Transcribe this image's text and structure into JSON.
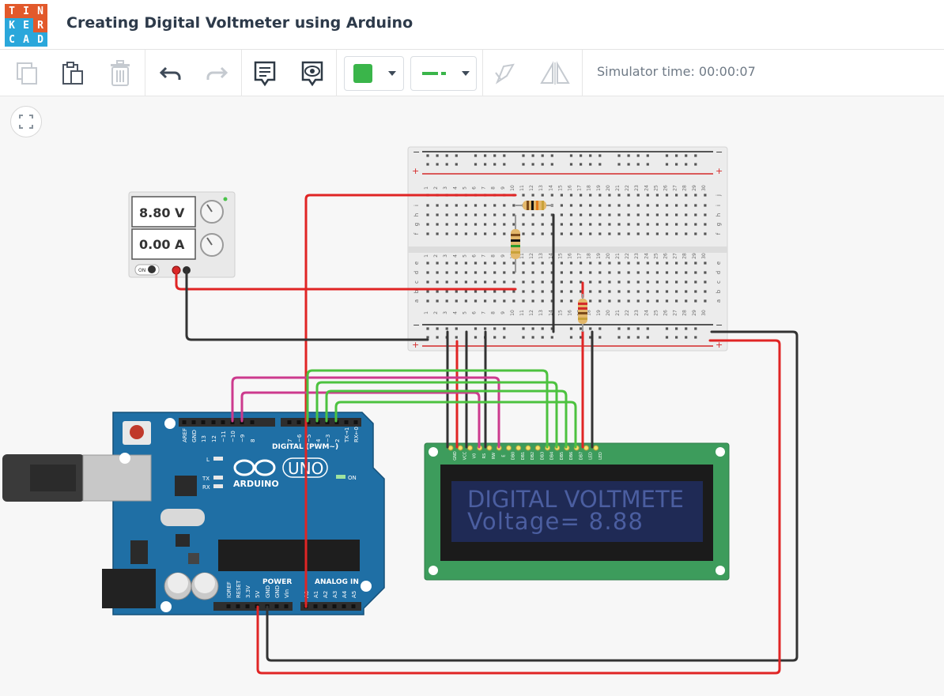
{
  "app": {
    "logo_letters": [
      "T",
      "I",
      "N",
      "K",
      "E",
      "R",
      "C",
      "A",
      "D"
    ],
    "logo_colors": [
      "#e2592b",
      "#e2592b",
      "#e2592b",
      "#2aa7db",
      "#2aa7db",
      "#e2592b",
      "#2aa7db",
      "#2aa7db",
      "#2aa7db"
    ],
    "title": "Creating Digital Voltmeter using Arduino"
  },
  "toolbar": {
    "copy_icon": "copy-icon",
    "paste_icon": "paste-icon",
    "delete_icon": "trash-icon",
    "undo_icon": "undo-icon",
    "redo_icon": "redo-icon",
    "notes_icon": "notes-icon",
    "view_icon": "eye-icon",
    "fill_color": "#3ab54a",
    "line_color": "#3ab54a",
    "rotate_icon": "rotate-icon",
    "mirror_icon": "mirror-icon",
    "simulator_time": "Simulator time: 00:00:07"
  },
  "power_supply": {
    "voltage": "8.80 V",
    "current": "0.00 A",
    "switch_label": "ON"
  },
  "breadboard": {
    "rail_minus": "−",
    "rail_plus": "+",
    "column_numbers": [
      "1",
      "2",
      "3",
      "4",
      "5",
      "6",
      "7",
      "8",
      "9",
      "10",
      "11",
      "12",
      "13",
      "14",
      "15",
      "16",
      "17",
      "18",
      "19",
      "20",
      "21",
      "22",
      "23",
      "24",
      "25",
      "26",
      "27",
      "28",
      "29",
      "30"
    ],
    "row_letters_top": [
      "j",
      "i",
      "h",
      "g",
      "f"
    ],
    "row_letters_bottom": [
      "e",
      "d",
      "c",
      "b",
      "a"
    ]
  },
  "arduino": {
    "logo_text": "ARDUINO",
    "model": "UNO",
    "digital_label": "DIGITAL (PWM~)",
    "power_label": "POWER",
    "analog_label": "ANALOG IN",
    "on_label": "ON",
    "tx_label": "TX",
    "rx_label": "RX",
    "l_label": "L",
    "digital_pins": [
      "AREF",
      "GND",
      "13",
      "12",
      "~11",
      "~10",
      "~9",
      "8",
      "7",
      "~6",
      "~5",
      "4",
      "~3",
      "2",
      "TX→1",
      "RX←0"
    ],
    "power_pins": [
      "IOREF",
      "RESET",
      "3.3V",
      "5V",
      "GND",
      "GND",
      "Vin"
    ],
    "analog_pins": [
      "A0",
      "A1",
      "A2",
      "A3",
      "A4",
      "A5"
    ]
  },
  "lcd": {
    "pins": [
      "GND",
      "VCC",
      "V0",
      "RS",
      "RW",
      "E",
      "DB0",
      "DB1",
      "DB2",
      "DB3",
      "DB4",
      "DB5",
      "DB6",
      "DB7",
      "LED",
      "LED"
    ],
    "line1": "DIGITAL VOLTMETE",
    "line2": "Voltage= 8.88"
  },
  "colors": {
    "wire_red": "#e02525",
    "wire_black": "#333333",
    "wire_green": "#4cc23f",
    "wire_magenta": "#cc3a8d",
    "arduino_blue": "#1f6fa5",
    "lcd_pcb": "#3d9c5c",
    "lcd_screen": "#1f2a55",
    "lcd_text": "#4b5ea0"
  }
}
